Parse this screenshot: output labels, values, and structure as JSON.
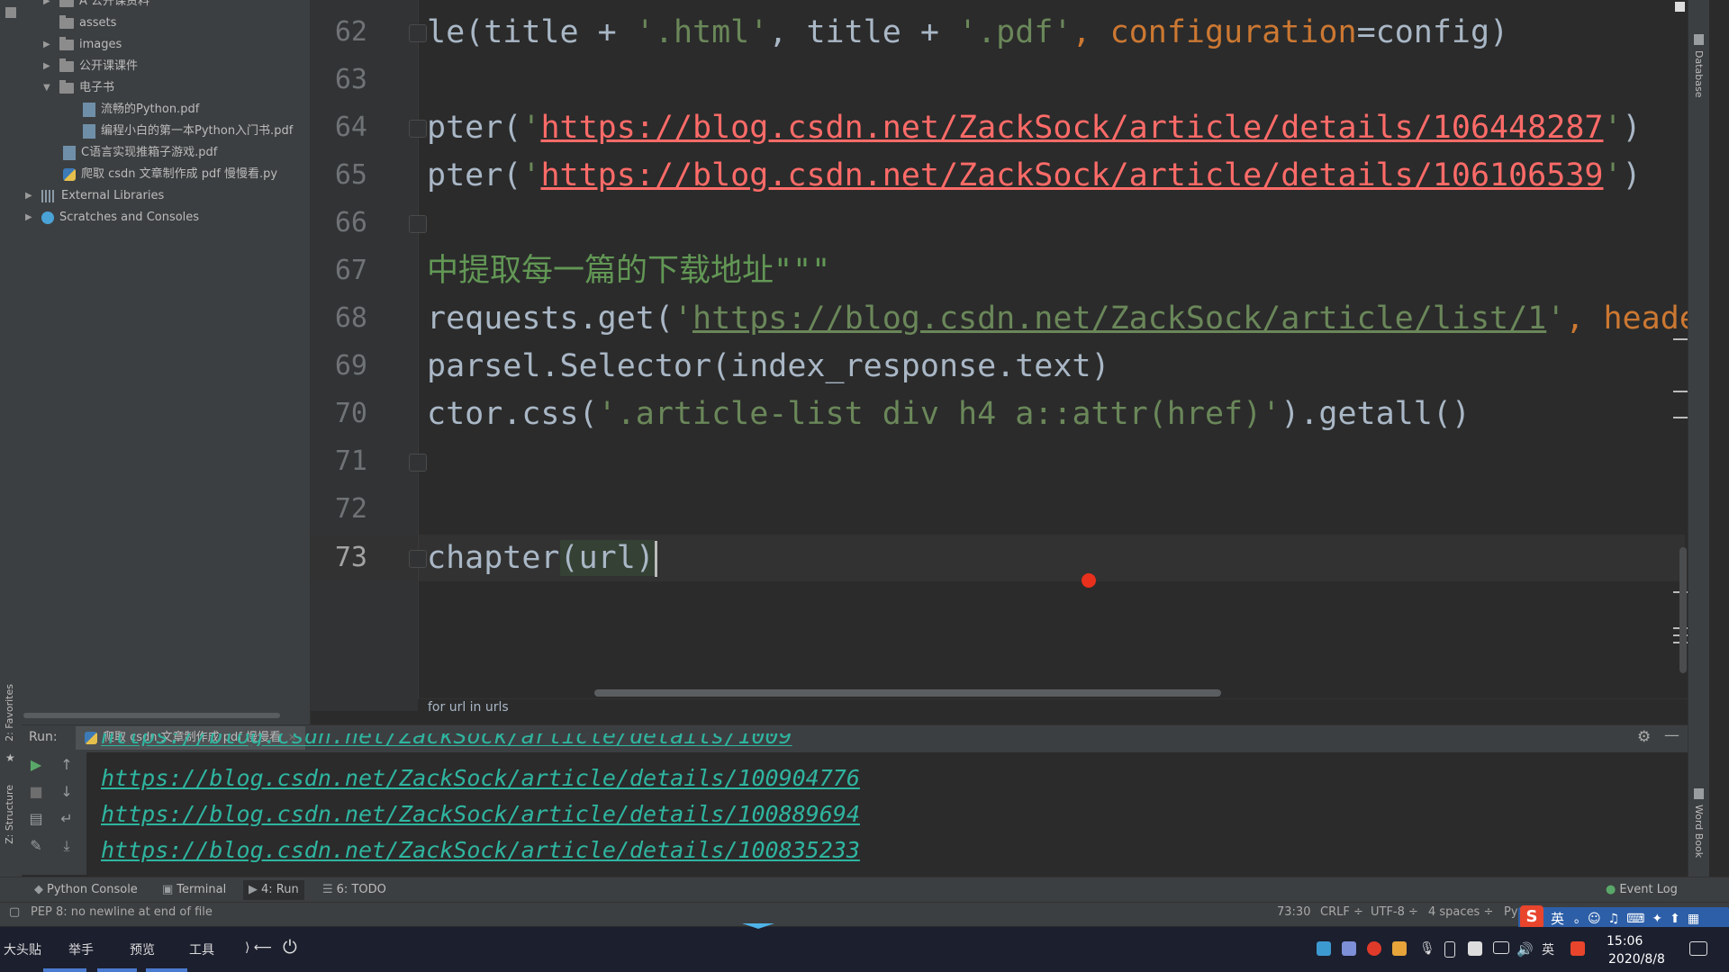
{
  "project_tree": {
    "items": [
      {
        "label": "A 公开课资料",
        "type": "folder",
        "expanded": false
      },
      {
        "label": "assets",
        "type": "folder",
        "expanded": null
      },
      {
        "label": "images",
        "type": "folder",
        "expanded": false
      },
      {
        "label": "公开课课件",
        "type": "folder",
        "expanded": false
      },
      {
        "label": "电子书",
        "type": "folder",
        "expanded": true
      },
      {
        "label": "流畅的Python.pdf",
        "type": "pdf"
      },
      {
        "label": "编程小白的第一本Python入门书.pdf",
        "type": "pdf"
      },
      {
        "label": "C语言实现推箱子游戏.pdf",
        "type": "pdf"
      },
      {
        "label": "爬取 csdn 文章制作成 pdf 慢慢看.py",
        "type": "python"
      },
      {
        "label": "External Libraries",
        "type": "library"
      },
      {
        "label": "Scratches and Consoles",
        "type": "scratches"
      }
    ]
  },
  "left_stripe": {
    "favorites": "2: Favorites",
    "structure": "Z: Structure"
  },
  "right_stripe": {
    "database": "Database",
    "wordbook": "Word Book"
  },
  "editor": {
    "current_line": "73",
    "line_numbers": [
      "62",
      "63",
      "64",
      "65",
      "66",
      "67",
      "68",
      "69",
      "70",
      "71",
      "72",
      "73"
    ],
    "lines": {
      "l62": {
        "a": "le(title + ",
        "b": "'.html'",
        "c": ", title + ",
        "d": "'.pdf'",
        "e": ", ",
        "f": "configuration",
        "g": "=config)"
      },
      "l64": {
        "a": "pter(",
        "b": "'",
        "url": "https://blog.csdn.net/ZackSock/article/details/106448287",
        "c": "'",
        "d": ")"
      },
      "l65": {
        "a": "pter(",
        "b": "'",
        "url": "https://blog.csdn.net/ZackSock/article/details/106106539",
        "c": "'",
        "d": ")"
      },
      "l67": {
        "a": "中提取每一篇的下载地址\"\"\""
      },
      "l68": {
        "a": "requests.get(",
        "b": "'",
        "url": "https://blog.csdn.net/ZackSock/article/list/1",
        "c": "'",
        "d": ", ",
        "e": "header"
      },
      "l69": {
        "a": "parsel.Selector(index_response.text)"
      },
      "l70": {
        "a": "ctor.css(",
        "b": "'.article-list div h4 a::attr(href)'",
        "c": ").getall()"
      },
      "l73": {
        "a": "chapter",
        "b": "(url)"
      }
    },
    "breadcrumb": "for url in urls"
  },
  "run_panel": {
    "label": "Run:",
    "tab_label": "爬取 csdn 文章制作成 pdf 慢慢看",
    "partial_line": "https://blog.csdn.net/ZackSock/article/details/1009",
    "output_lines": [
      "https://blog.csdn.net/ZackSock/article/details/100904776",
      "https://blog.csdn.net/ZackSock/article/details/100889694",
      "https://blog.csdn.net/ZackSock/article/details/100835233"
    ]
  },
  "bottom_tabs": {
    "python_console": "Python Console",
    "terminal": "Terminal",
    "run": "4: Run",
    "todo": "6: TODO",
    "event_log": "Event Log"
  },
  "status_bar": {
    "message": "PEP 8: no newline at end of file",
    "position": "73:30",
    "line_sep": "CRLF ÷",
    "encoding": "UTF-8 ÷",
    "indent": "4 spaces ÷",
    "interpreter": "Py"
  },
  "taskbar": {
    "items": [
      "大头贴",
      "举手",
      "预览",
      "工具"
    ],
    "tray_lang": "英",
    "time": "15:06",
    "date": "2020/8/8"
  },
  "ime": {
    "mode": "英"
  }
}
